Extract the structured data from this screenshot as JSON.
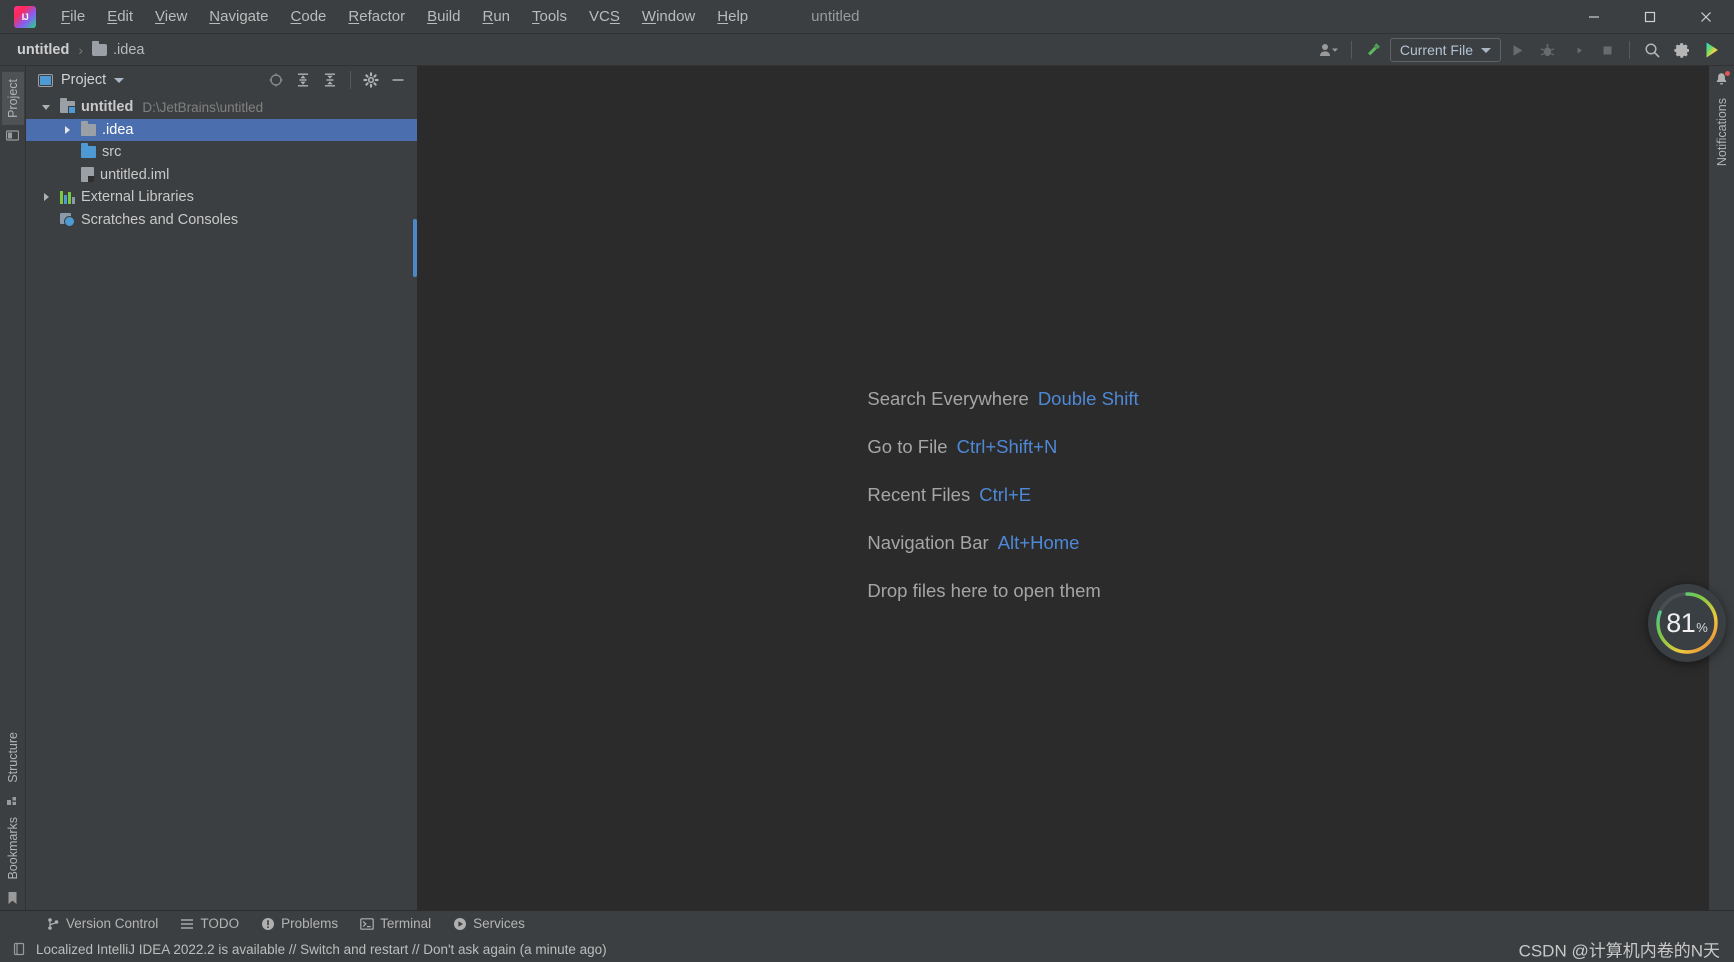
{
  "window": {
    "title": "untitled",
    "controls": {
      "minimize": "—",
      "maximize": "▢",
      "close": "✕"
    }
  },
  "menu": {
    "items": [
      {
        "label": "File",
        "mnemonic": "F"
      },
      {
        "label": "Edit",
        "mnemonic": "E"
      },
      {
        "label": "View",
        "mnemonic": "V"
      },
      {
        "label": "Navigate",
        "mnemonic": "N"
      },
      {
        "label": "Code",
        "mnemonic": "C"
      },
      {
        "label": "Refactor",
        "mnemonic": "R"
      },
      {
        "label": "Build",
        "mnemonic": "B"
      },
      {
        "label": "Run",
        "mnemonic": "R"
      },
      {
        "label": "Tools",
        "mnemonic": "T"
      },
      {
        "label": "VCS",
        "mnemonic": "S"
      },
      {
        "label": "Window",
        "mnemonic": "W"
      },
      {
        "label": "Help",
        "mnemonic": "H"
      }
    ]
  },
  "navbar": {
    "breadcrumb": [
      {
        "label": "untitled",
        "icon": "project-icon"
      },
      {
        "label": ".idea",
        "icon": "folder-icon"
      }
    ],
    "separator": "›",
    "run_config": "Current File",
    "actions": [
      {
        "name": "user-accounts-icon",
        "title": "Account"
      },
      {
        "name": "build-hammer-icon",
        "title": "Build Project"
      },
      {
        "name": "run-icon",
        "title": "Run"
      },
      {
        "name": "debug-icon",
        "title": "Debug"
      },
      {
        "name": "run-coverage-icon",
        "title": "Run with Coverage"
      },
      {
        "name": "stop-icon",
        "title": "Stop"
      },
      {
        "name": "search-icon",
        "title": "Search Everywhere"
      },
      {
        "name": "settings-gear-icon",
        "title": "Settings"
      },
      {
        "name": "ai-assistant-icon",
        "title": "Assistant"
      }
    ]
  },
  "left_rail": {
    "top": [
      {
        "label": "Project",
        "icon": "project-window-icon",
        "active": true
      }
    ],
    "bottom": [
      {
        "label": "Structure",
        "icon": "structure-icon"
      },
      {
        "label": "Bookmarks",
        "icon": "bookmark-icon"
      }
    ]
  },
  "right_rail": {
    "items": [
      {
        "label": "Notifications",
        "icon": "bell-icon",
        "badge": true
      }
    ]
  },
  "project_panel": {
    "title": "Project",
    "tools": [
      {
        "name": "select-opened-file-icon",
        "title": "Select Opened File"
      },
      {
        "name": "expand-all-icon",
        "title": "Expand All"
      },
      {
        "name": "collapse-all-icon",
        "title": "Collapse All"
      },
      {
        "name": "options-gear-icon",
        "title": "Options"
      },
      {
        "name": "hide-panel-icon",
        "title": "Hide"
      }
    ],
    "tree": [
      {
        "label": "untitled",
        "path": "D:\\JetBrains\\untitled",
        "icon": "module-icon",
        "arrow": "open",
        "indent": 0,
        "bold": true,
        "selected": false
      },
      {
        "label": ".idea",
        "path": "",
        "icon": "folder-icon",
        "arrow": "closed",
        "indent": 1,
        "bold": false,
        "selected": true
      },
      {
        "label": "src",
        "path": "",
        "icon": "source-folder-icon",
        "arrow": "none",
        "indent": 1,
        "bold": false,
        "selected": false
      },
      {
        "label": "untitled.iml",
        "path": "",
        "icon": "iml-file-icon",
        "arrow": "none",
        "indent": 1,
        "bold": false,
        "selected": false
      },
      {
        "label": "External Libraries",
        "path": "",
        "icon": "library-icon",
        "arrow": "closed",
        "indent": 0,
        "bold": false,
        "selected": false
      },
      {
        "label": "Scratches and Consoles",
        "path": "",
        "icon": "scratches-icon",
        "arrow": "none",
        "indent": 0,
        "bold": false,
        "selected": false
      }
    ]
  },
  "editor": {
    "hints": [
      {
        "action": "Search Everywhere",
        "shortcut": "Double Shift"
      },
      {
        "action": "Go to File",
        "shortcut": "Ctrl+Shift+N"
      },
      {
        "action": "Recent Files",
        "shortcut": "Ctrl+E"
      },
      {
        "action": "Navigation Bar",
        "shortcut": "Alt+Home"
      },
      {
        "action": "Drop files here to open them",
        "shortcut": ""
      }
    ]
  },
  "battery": {
    "value": "81",
    "unit": "%",
    "percent": 81
  },
  "tool_window_bar": {
    "items": [
      {
        "label": "Version Control",
        "icon": "branch-icon"
      },
      {
        "label": "TODO",
        "icon": "list-icon"
      },
      {
        "label": "Problems",
        "icon": "warning-icon"
      },
      {
        "label": "Terminal",
        "icon": "terminal-icon"
      },
      {
        "label": "Services",
        "icon": "services-icon"
      }
    ]
  },
  "statusbar": {
    "icon": "ide-update-icon",
    "message": "Localized IntelliJ IDEA 2022.2 is available // Switch and restart // Don't ask again (a minute ago)",
    "watermark": "CSDN @计算机内卷的N天"
  },
  "colors": {
    "panel_bg": "#3c3f41",
    "editor_bg": "#2b2b2b",
    "selection_blue": "#4b6eaf",
    "accent_blue": "#4e88d6",
    "text": "#bbbbbb"
  }
}
